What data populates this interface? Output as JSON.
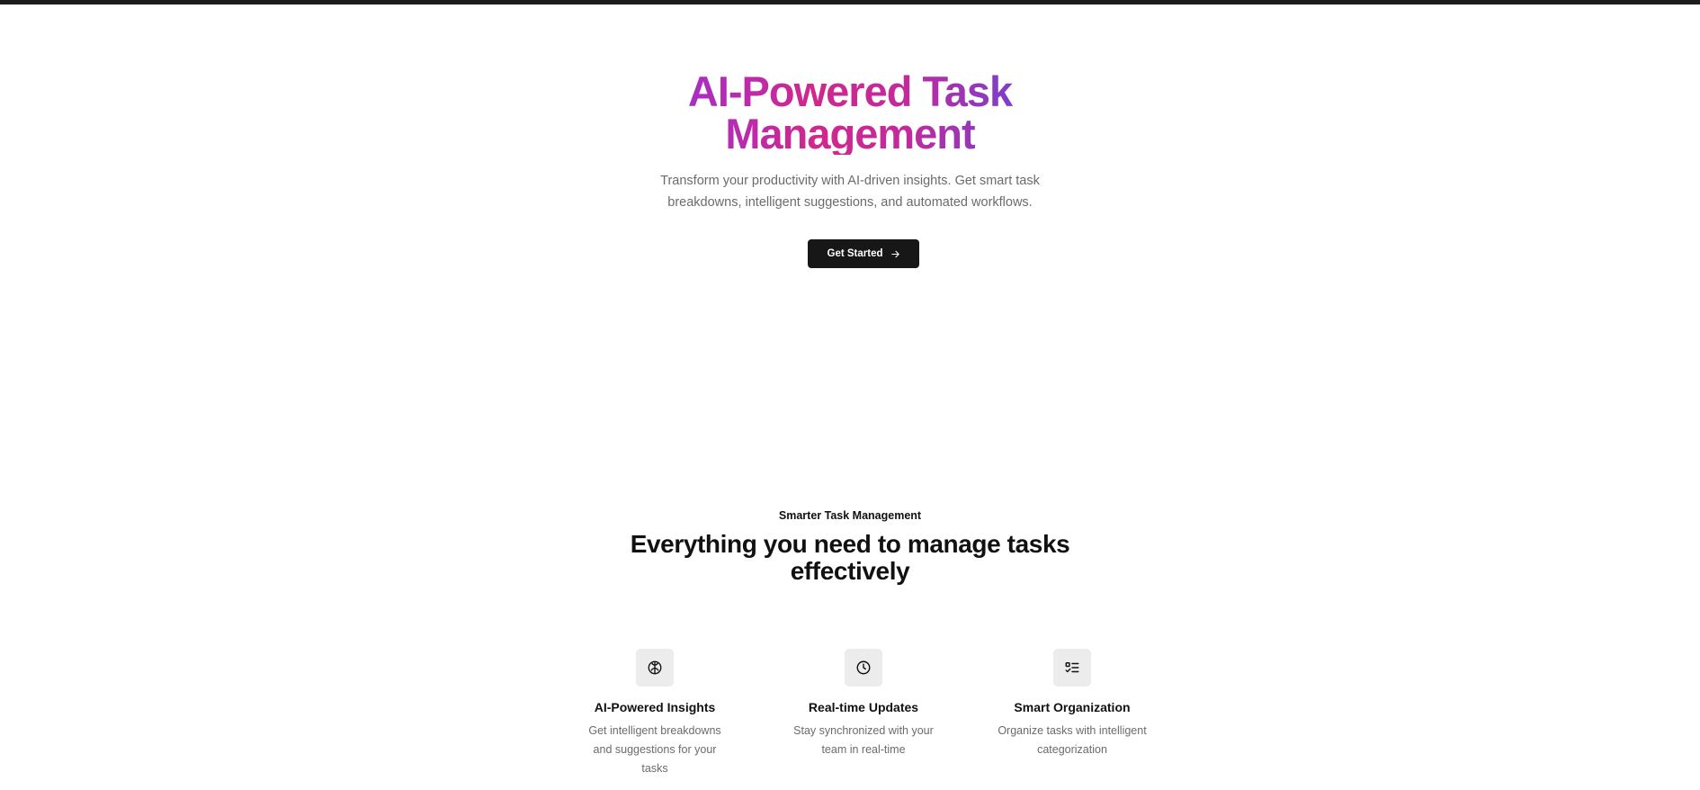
{
  "hero": {
    "title": "AI-Powered Task Management",
    "subtitle": "Transform your productivity with AI-driven insights. Get smart task breakdowns, intelligent suggestions, and automated workflows.",
    "cta_label": "Get Started",
    "cta_icon": "arrow-right-icon"
  },
  "features_section": {
    "eyebrow": "Smarter Task Management",
    "title": "Everything you need to manage tasks effectively",
    "items": [
      {
        "icon": "brain-icon",
        "title": "AI-Powered Insights",
        "description": "Get intelligent breakdowns and suggestions for your tasks"
      },
      {
        "icon": "clock-icon",
        "title": "Real-time Updates",
        "description": "Stay synchronized with your team in real-time"
      },
      {
        "icon": "list-checks-icon",
        "title": "Smart Organization",
        "description": "Organize tasks with intelligent categorization"
      }
    ]
  },
  "colors": {
    "topbar": "#1c1c1c",
    "button": "#171717",
    "gradient_start": "#a02fd0",
    "gradient_mid": "#d0288c",
    "gradient_end": "#6b44d6",
    "muted_text": "#6b6b6b",
    "icon_box": "#ececec"
  }
}
